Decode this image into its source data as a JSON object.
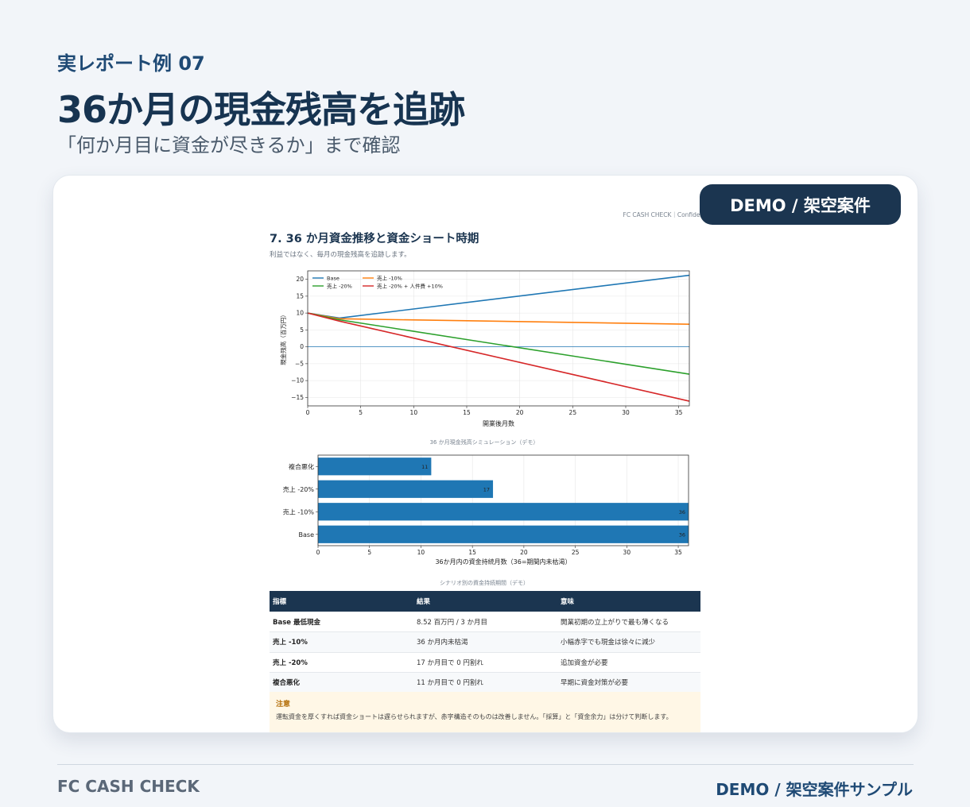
{
  "eyebrow": "実レポート例 07",
  "title": "36か月の現金残高を追跡",
  "subtitle": "「何か月目に資金が尽きるか」まで確認",
  "badge": "DEMO / 架空案件",
  "report": {
    "header_note": "FC CASH CHECK｜Confidential",
    "section_title": "7. 36 か月資金推移と資金ショート時期",
    "section_desc": "利益ではなく、毎月の現金残高を追跡します。",
    "chart1_caption": "36 か月現金残高シミュレーション（デモ）",
    "chart2_caption": "シナリオ別の資金持続期間（デモ）",
    "table": {
      "headers": [
        "指標",
        "結果",
        "意味"
      ],
      "rows": [
        [
          "Base 最低現金",
          "8.52 百万円 / 3 か月目",
          "開業初期の立上がりで最も薄くなる"
        ],
        [
          "売上 -10%",
          "36 か月内未枯渇",
          "小幅赤字でも現金は徐々に減少"
        ],
        [
          "売上 -20%",
          "17 か月目で 0 円割れ",
          "追加資金が必要"
        ],
        [
          "複合悪化",
          "11 か月目で 0 円割れ",
          "早期に資金対策が必要"
        ]
      ]
    },
    "note": {
      "title": "注意",
      "text": "運転資金を厚くすれば資金ショートは遅らせられますが、赤字構造そのものは改善しません。「採算」と「資金余力」は分けて判断します。"
    }
  },
  "footer": {
    "left": "FC CASH CHECK",
    "right": "DEMO / 架空案件サンプル"
  },
  "chart_data": [
    {
      "type": "line",
      "title": "36 か月現金残高シミュレーション（デモ）",
      "xlabel": "開業後月数",
      "ylabel": "現金残高（百万円）",
      "xlim": [
        0,
        36
      ],
      "ylim": [
        -17.5,
        22.5
      ],
      "xticks": [
        0,
        5,
        10,
        15,
        20,
        25,
        30,
        35
      ],
      "yticks": [
        20,
        15,
        10,
        5,
        0,
        -5,
        -10,
        -15
      ],
      "grid": true,
      "legend": "top-left",
      "series": [
        {
          "name": "Base",
          "color": "#1f77b4",
          "x": [
            0,
            3,
            36
          ],
          "y": [
            10,
            8.52,
            21.2
          ]
        },
        {
          "name": "売上 -10%",
          "color": "#ff7f0e",
          "x": [
            0,
            3,
            36
          ],
          "y": [
            10,
            8.3,
            6.7
          ]
        },
        {
          "name": "売上 -20%",
          "color": "#2ca02c",
          "x": [
            0,
            3,
            36
          ],
          "y": [
            10,
            8.0,
            -8.1
          ]
        },
        {
          "name": "売上 -20% + 人件費 +10%",
          "color": "#d62728",
          "x": [
            0,
            3,
            36
          ],
          "y": [
            10,
            7.6,
            -16.1
          ]
        }
      ]
    },
    {
      "type": "bar",
      "orientation": "horizontal",
      "title": "シナリオ別の資金持続期間（デモ）",
      "xlabel": "36か月内の資金持続月数（36=期間内未枯渇）",
      "categories": [
        "複合悪化",
        "売上 -20%",
        "売上 -10%",
        "Base"
      ],
      "values": [
        11,
        17,
        36,
        36
      ],
      "xlim": [
        0,
        36
      ],
      "xticks": [
        0,
        5,
        10,
        15,
        20,
        25,
        30,
        35
      ],
      "color": "#1f77b4",
      "grid": true
    }
  ]
}
